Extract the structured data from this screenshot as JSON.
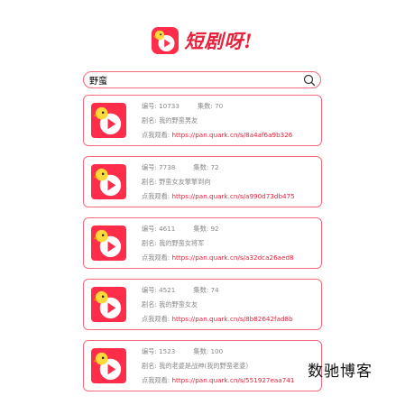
{
  "app": {
    "title": "短剧呀!"
  },
  "search": {
    "value": "野蛮"
  },
  "results": [
    {
      "id_label": "编号: ",
      "id": "10733",
      "count_label": "集数: ",
      "count": "70",
      "title_label": "剧名: ",
      "title": "我的野蛮男友",
      "watch_label": "点我观看: ",
      "url": "https://pan.quark.cn/s/8a4af6a9b326"
    },
    {
      "id_label": "编号: ",
      "id": "7738",
      "count_label": "集数: ",
      "count": "72",
      "title_label": "剧名: ",
      "title": "野蛮女友擎擎到向",
      "watch_label": "点我观看: ",
      "url": "https://pan.quark.cn/s/a990d73db475"
    },
    {
      "id_label": "编号: ",
      "id": "4611",
      "count_label": "集数: ",
      "count": "92",
      "title_label": "剧名: ",
      "title": "我的野蛮女将军",
      "watch_label": "点我观看: ",
      "url": "https://pan.quark.cn/s/a32dca26aed8"
    },
    {
      "id_label": "编号: ",
      "id": "4521",
      "count_label": "集数: ",
      "count": "74",
      "title_label": "剧名: ",
      "title": "我的野蛮女友",
      "watch_label": "点我观看: ",
      "url": "https://pan.quark.cn/s/8b82642fad8b"
    },
    {
      "id_label": "编号: ",
      "id": "1523",
      "count_label": "集数: ",
      "count": "100",
      "title_label": "剧名: ",
      "title": "我的老婆是战神(我的野蛮老婆)",
      "watch_label": "点我观看: ",
      "url": "https://pan.quark.cn/s/551927eaa741"
    }
  ],
  "watermark": "数驰博客",
  "colors": {
    "brand": "#ff2d4a",
    "accent_text": "#e8213a",
    "border": "#f06a7c"
  },
  "icons": {
    "logo": "duck-play-logo-icon",
    "search": "search-icon"
  }
}
